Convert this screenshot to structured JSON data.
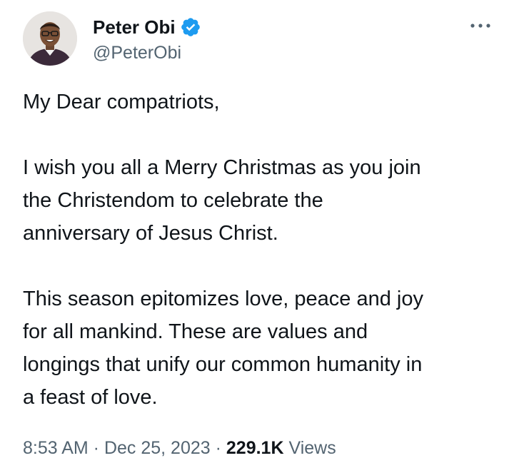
{
  "author": {
    "display_name": "Peter Obi",
    "handle": "@PeterObi",
    "verified_icon": "verified-badge-icon",
    "avatar_icon": "avatar"
  },
  "more_icon": "more-options-icon",
  "tweet": {
    "paragraphs": [
      "My Dear compatriots,",
      "I wish you all a Merry Christmas as you join\nthe Christendom to celebrate the\nanniversary of Jesus Christ.",
      "This season epitomizes love, peace and joy\nfor all mankind. These are values and\nlongings that unify our common humanity in\na feast of love."
    ]
  },
  "meta": {
    "time": "8:53 AM",
    "separator": " · ",
    "date": "Dec 25, 2023",
    "views_count": "229.1K",
    "views_label": "Views"
  },
  "colors": {
    "verified_blue": "#1d9bf0",
    "secondary_text": "#536471",
    "primary_text": "#0f1419"
  }
}
